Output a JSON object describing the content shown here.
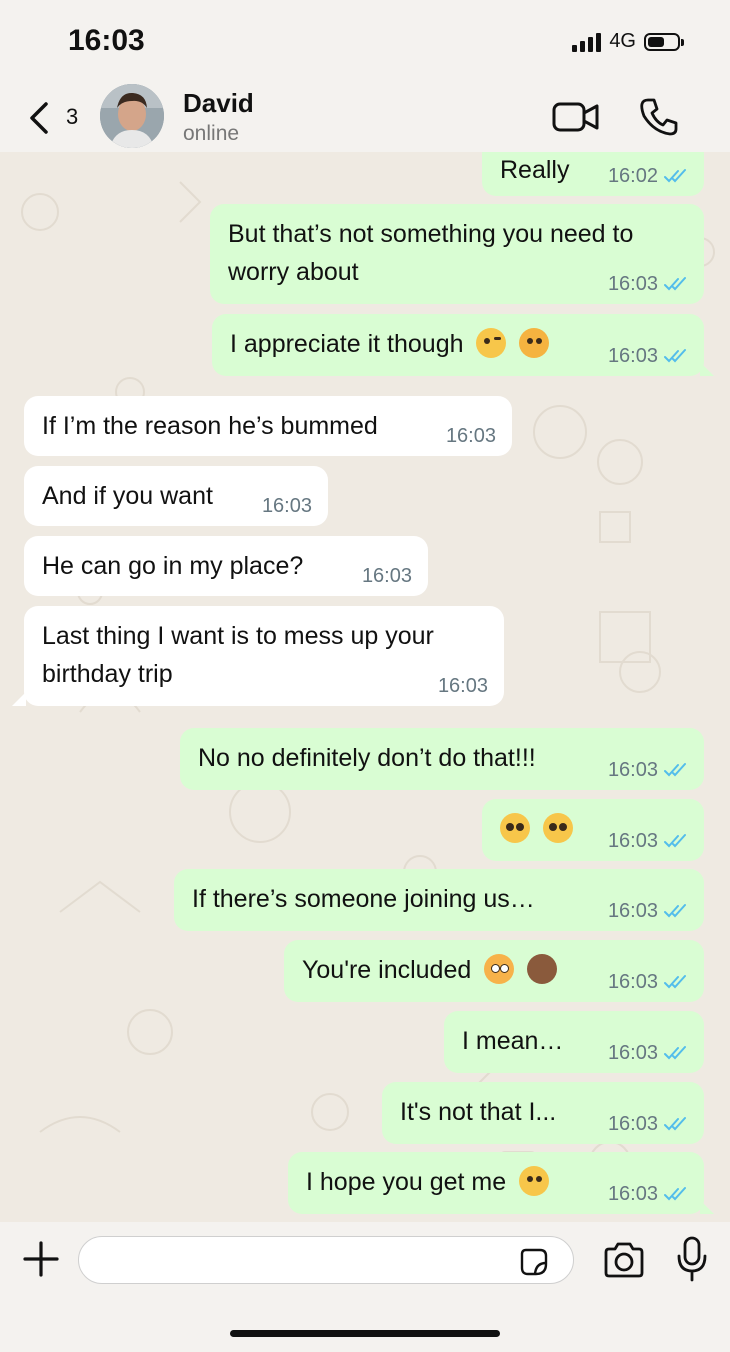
{
  "status_bar": {
    "time": "16:03",
    "network": "4G"
  },
  "header": {
    "back_count": "3",
    "contact_name": "David",
    "contact_status": "online"
  },
  "colors": {
    "outgoing_bubble": "#d9fdd3",
    "incoming_bubble": "#ffffff",
    "read_ticks": "#53bdeb",
    "chat_background": "#efeae2"
  },
  "messages": [
    {
      "direction": "out",
      "text": "Really",
      "time": "16:02",
      "status": "read"
    },
    {
      "direction": "out",
      "text": "But that’s not something you need to worry about",
      "time": "16:03",
      "status": "read"
    },
    {
      "direction": "out",
      "text": "I appreciate it though",
      "emojis": [
        "face-blowing-kiss",
        "face-with-hand-over-mouth"
      ],
      "time": "16:03",
      "status": "read"
    },
    {
      "direction": "in",
      "text": "If I’m the reason he’s bummed",
      "time": "16:03"
    },
    {
      "direction": "in",
      "text": "And if you want",
      "time": "16:03"
    },
    {
      "direction": "in",
      "text": "He can go in my place?",
      "time": "16:03"
    },
    {
      "direction": "in",
      "text": "Last thing I want is to mess up your birthday trip",
      "time": "16:03"
    },
    {
      "direction": "out",
      "text": "No no definitely don’t do that!!!",
      "time": "16:03",
      "status": "read"
    },
    {
      "direction": "out",
      "text": "",
      "emojis": [
        "pleading-face",
        "pleading-face"
      ],
      "time": "16:03",
      "status": "read"
    },
    {
      "direction": "out",
      "text": "If there’s someone joining us…",
      "time": "16:03",
      "status": "read"
    },
    {
      "direction": "out",
      "text": "You're included",
      "emojis": [
        "flushed-face",
        "see-no-evil-monkey"
      ],
      "time": "16:03",
      "status": "read"
    },
    {
      "direction": "out",
      "text": "I mean…",
      "time": "16:03",
      "status": "read"
    },
    {
      "direction": "out",
      "text": "It's not that I...",
      "time": "16:03",
      "status": "read"
    },
    {
      "direction": "out",
      "text": "I hope you get me",
      "emojis": [
        "grimacing-face"
      ],
      "time": "16:03",
      "status": "read"
    }
  ],
  "composer": {
    "placeholder": ""
  }
}
